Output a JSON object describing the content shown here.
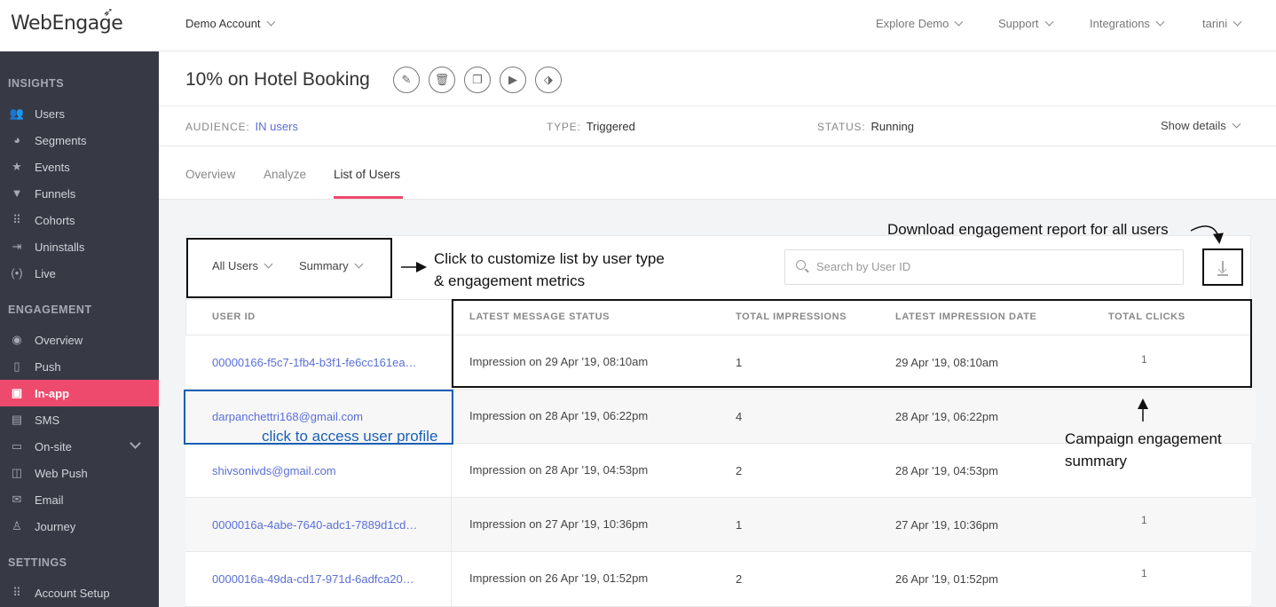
{
  "topbar": {
    "logo": "WebEngage",
    "account": "Demo Account",
    "nav": [
      "Explore Demo",
      "Support",
      "Integrations",
      "tarini"
    ]
  },
  "sidebar": {
    "sections": [
      {
        "title": "INSIGHTS",
        "items": [
          {
            "label": "Users",
            "icon": "users-icon"
          },
          {
            "label": "Segments",
            "icon": "pie-icon"
          },
          {
            "label": "Events",
            "icon": "star-icon"
          },
          {
            "label": "Funnels",
            "icon": "funnel-icon"
          },
          {
            "label": "Cohorts",
            "icon": "grid-icon"
          },
          {
            "label": "Uninstalls",
            "icon": "uninstall-icon"
          },
          {
            "label": "Live",
            "icon": "live-icon"
          }
        ]
      },
      {
        "title": "ENGAGEMENT",
        "items": [
          {
            "label": "Overview",
            "icon": "eye-icon"
          },
          {
            "label": "Push",
            "icon": "phone-icon"
          },
          {
            "label": "In-app",
            "icon": "inapp-icon",
            "active": true
          },
          {
            "label": "SMS",
            "icon": "sms-icon"
          },
          {
            "label": "On-site",
            "icon": "onsite-icon"
          },
          {
            "label": "Web Push",
            "icon": "webpush-icon"
          },
          {
            "label": "Email",
            "icon": "email-icon"
          },
          {
            "label": "Journey",
            "icon": "journey-icon"
          }
        ]
      },
      {
        "title": "SETTINGS",
        "items": [
          {
            "label": "Account Setup",
            "icon": "grid-icon"
          }
        ]
      }
    ]
  },
  "campaign": {
    "title": "10% on Hotel Booking",
    "audience_key": "AUDIENCE:",
    "audience_value": "IN users",
    "type_key": "TYPE:",
    "type_value": "Triggered",
    "status_key": "STATUS:",
    "status_value": "Running",
    "show_details": "Show details",
    "tabs": [
      "Overview",
      "Analyze",
      "List of Users"
    ]
  },
  "filters": {
    "user_type": "All Users",
    "view": "Summary"
  },
  "search": {
    "placeholder": "Search by User ID"
  },
  "table": {
    "headers": [
      "USER ID",
      "LATEST MESSAGE STATUS",
      "TOTAL IMPRESSIONS",
      "LATEST IMPRESSION DATE",
      "TOTAL CLICKS"
    ],
    "rows": [
      {
        "user": "00000166-f5c7-1fb4-b3f1-fe6cc161ea…",
        "status": "Impression on 29 Apr '19, 08:10am",
        "impressions": "1",
        "date": "29 Apr '19, 08:10am",
        "clicks": "1"
      },
      {
        "user": "darpanchettri168@gmail.com",
        "status": "Impression on 28 Apr '19, 06:22pm",
        "impressions": "4",
        "date": "28 Apr '19, 06:22pm",
        "clicks": ""
      },
      {
        "user": "shivsonivds@gmail.com",
        "status": "Impression on 28 Apr '19, 04:53pm",
        "impressions": "2",
        "date": "28 Apr '19, 04:53pm",
        "clicks": ""
      },
      {
        "user": "0000016a-4abe-7640-adc1-7889d1cd…",
        "status": "Impression on 27 Apr '19, 10:36pm",
        "impressions": "1",
        "date": "27 Apr '19, 10:36pm",
        "clicks": "1"
      },
      {
        "user": "0000016a-49da-cd17-971d-6adfca20…",
        "status": "Impression on 26 Apr '19, 01:52pm",
        "impressions": "2",
        "date": "26 Apr '19, 01:52pm",
        "clicks": "1"
      }
    ]
  },
  "annotations": {
    "download": "Download engagement report for all users",
    "customize_line1": "Click to customize list by user type",
    "customize_line2": "& engagement metrics",
    "profile": "click to access user profile",
    "summary_line1": "Campaign engagement",
    "summary_line2": "summary"
  }
}
